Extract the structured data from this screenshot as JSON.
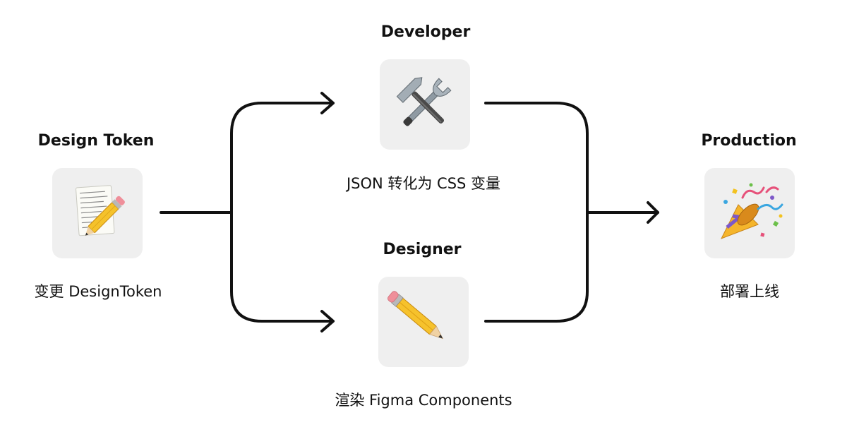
{
  "nodes": {
    "design_token": {
      "title": "Design Token",
      "caption": "变更 DesignToken",
      "icon": "memo-icon"
    },
    "developer": {
      "title": "Developer",
      "caption": "JSON 转化为 CSS 变量",
      "icon": "hammer-and-wrench-icon"
    },
    "designer": {
      "title": "Designer",
      "caption": "渲染 Figma Components",
      "icon": "pencil-icon"
    },
    "production": {
      "title": "Production",
      "caption": "部署上线",
      "icon": "party-popper-icon"
    }
  },
  "colors": {
    "tile_background": "#efefef",
    "connector": "#111111",
    "text": "#111111"
  }
}
